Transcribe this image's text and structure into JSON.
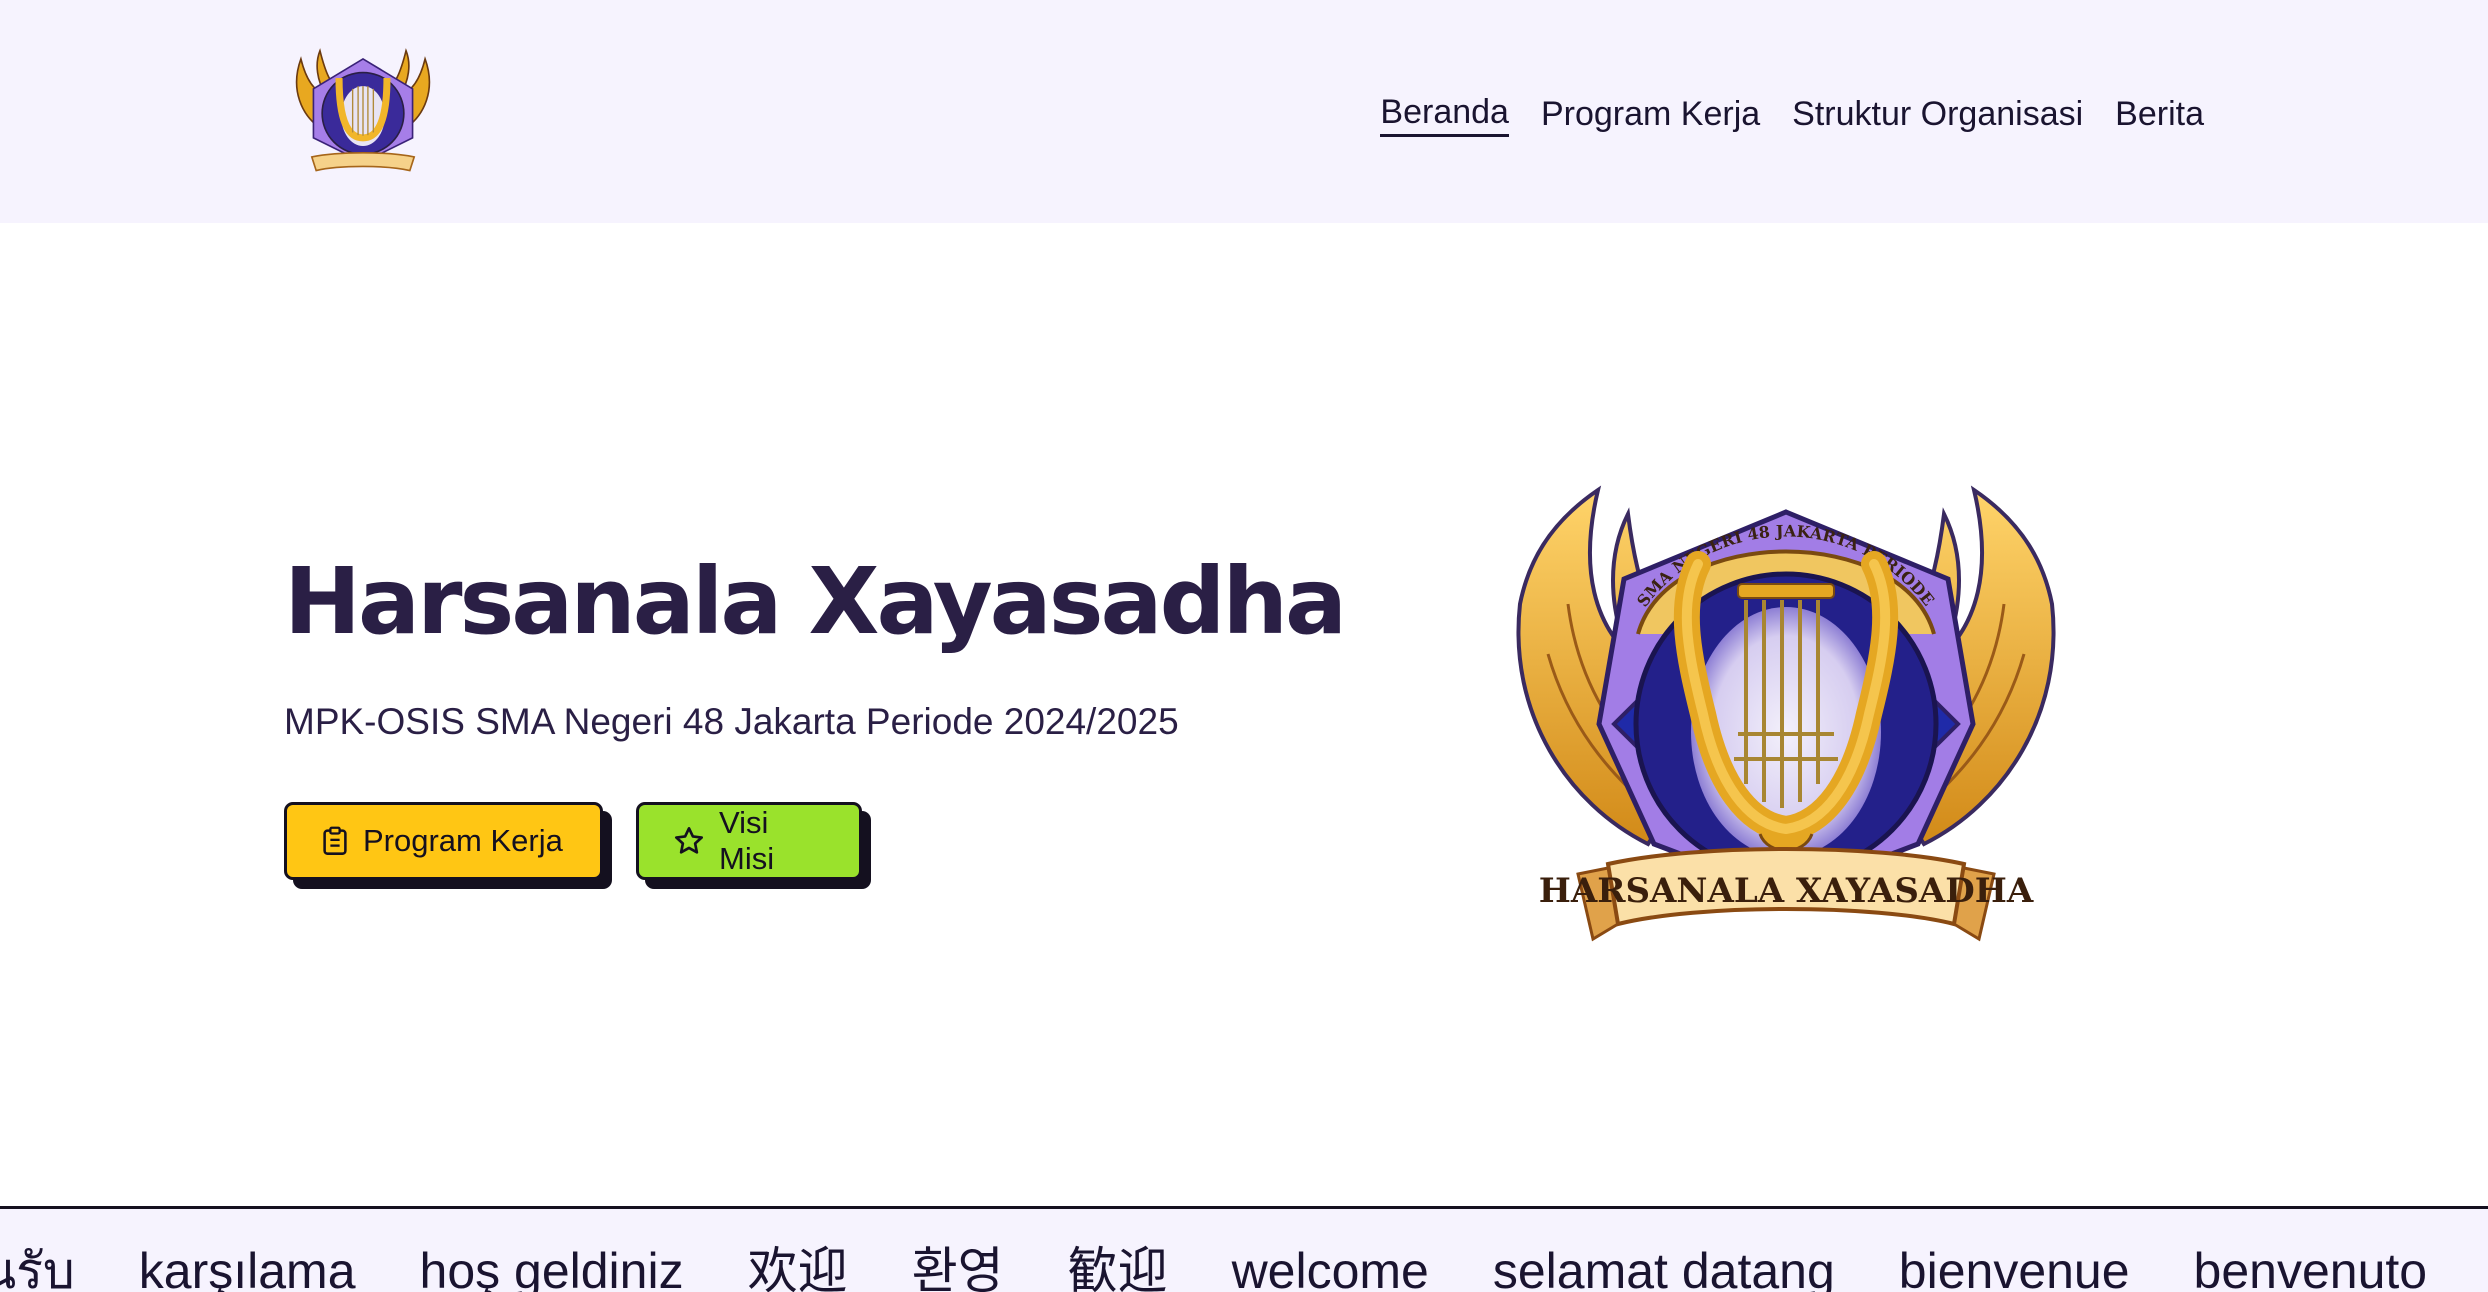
{
  "header": {
    "logo_alt": "Harsanala Xayasadha logo",
    "nav": [
      {
        "label": "Beranda",
        "active": true
      },
      {
        "label": "Program Kerja",
        "active": false
      },
      {
        "label": "Struktur Organisasi",
        "active": false
      },
      {
        "label": "Berita",
        "active": false
      }
    ]
  },
  "hero": {
    "title": "Harsanala Xayasadha",
    "subtitle": "MPK-OSIS SMA Negeri 48 Jakarta Periode 2024/2025",
    "buttons": {
      "program_kerja": {
        "label": "Program Kerja",
        "icon": "clipboard-icon",
        "color": "#ffc614"
      },
      "visi_misi": {
        "label": "Visi Misi",
        "icon": "star-icon",
        "color": "#9ae22c"
      }
    },
    "emblem": {
      "ring_text": "MPK-OSIS SMA NEGERI 48 JAKARTA PERIODE 2024/2025",
      "banner_text": "HARSANALA XAYASADHA"
    }
  },
  "marquee": {
    "words": [
      "นรับ",
      "karşılama",
      "hoş geldiniz",
      "欢迎",
      "환영",
      "歓迎",
      "welcome",
      "selamat datang",
      "bienvenue",
      "benvenuto"
    ]
  },
  "colors": {
    "header_bg": "#f6f3fe",
    "title": "#2a1f45",
    "gold": "#e8a820",
    "purple": "#8b5cd6"
  }
}
